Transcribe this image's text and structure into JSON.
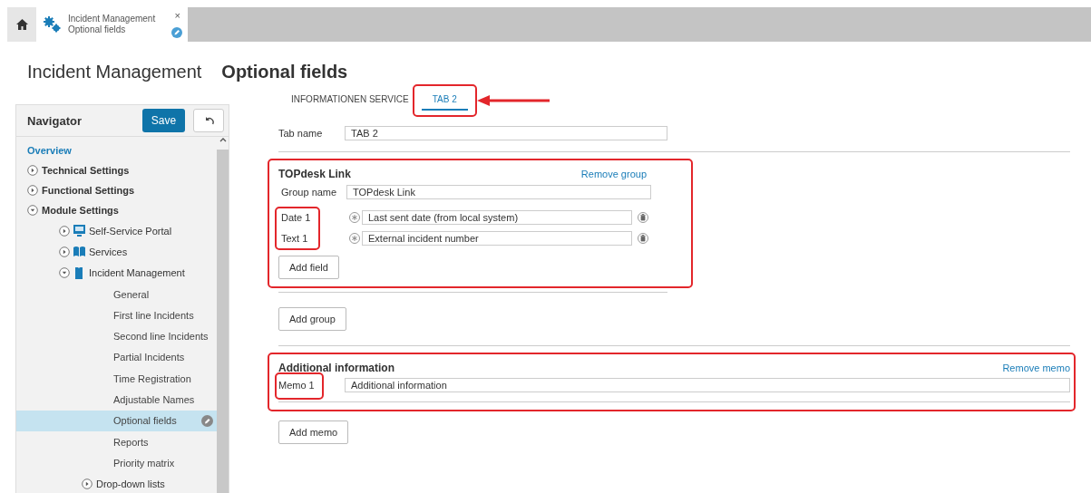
{
  "tab_bar": {
    "tabs": [
      {
        "kind": "home",
        "selected": false
      },
      {
        "kind": "page",
        "title": "Incident Management",
        "subtitle": "Optional fields",
        "close": "×",
        "selected": true
      }
    ]
  },
  "page_title": {
    "module": "Incident Management",
    "page": "Optional fields"
  },
  "navigator": {
    "title": "Navigator",
    "save": "Save",
    "items": [
      {
        "kind": "link",
        "label": "Overview",
        "selected": false
      },
      {
        "kind": "section",
        "label": "Technical Settings",
        "expanded": false,
        "selected": false
      },
      {
        "kind": "section",
        "label": "Functional Settings",
        "expanded": false,
        "selected": false
      },
      {
        "kind": "section",
        "label": "Module Settings",
        "expanded": true,
        "selected": false,
        "children": [
          {
            "kind": "portal",
            "label": "Self-Service Portal",
            "expanded": false,
            "selected": false
          },
          {
            "kind": "catalog",
            "label": "Services",
            "expanded": false,
            "selected": false
          },
          {
            "kind": "module",
            "label": "Incident Management",
            "expanded": true,
            "selected": false,
            "children": [
              {
                "kind": "page",
                "label": "General",
                "selected": false
              },
              {
                "kind": "page",
                "label": "First line Incidents",
                "selected": false
              },
              {
                "kind": "page",
                "label": "Second line Incidents",
                "selected": false
              },
              {
                "kind": "page",
                "label": "Partial Incidents",
                "selected": false
              },
              {
                "kind": "page",
                "label": "Time Registration",
                "selected": false
              },
              {
                "kind": "page",
                "label": "Adjustable Names",
                "selected": false
              },
              {
                "kind": "page",
                "label": "Optional fields",
                "selected": true
              },
              {
                "kind": "page",
                "label": "Reports",
                "selected": false
              },
              {
                "kind": "page",
                "label": "Priority matrix",
                "selected": false
              },
              {
                "kind": "folder",
                "label": "Drop-down lists",
                "expanded": false,
                "selected": false
              }
            ]
          }
        ]
      }
    ]
  },
  "editor": {
    "tabs": [
      {
        "label": "INFORMATIONEN SERVICE",
        "selected": false
      },
      {
        "label": "TAB 2",
        "selected": true
      }
    ],
    "tab_name": {
      "label": "Tab name",
      "value": "TAB 2"
    },
    "groups": [
      {
        "title": "TOPdesk Link",
        "remove": "Remove group",
        "name_label": "Group name",
        "name_value": "TOPdesk Link",
        "fields": [
          {
            "label": "Date 1",
            "value": "Last sent date (from local system)"
          },
          {
            "label": "Text 1",
            "value": "External incident number"
          }
        ],
        "add_field": "Add field"
      }
    ],
    "add_group": "Add group",
    "memos": [
      {
        "title": "Additional information",
        "remove": "Remove memo",
        "label": "Memo 1",
        "value": "Additional information"
      }
    ],
    "add_memo": "Add memo"
  }
}
